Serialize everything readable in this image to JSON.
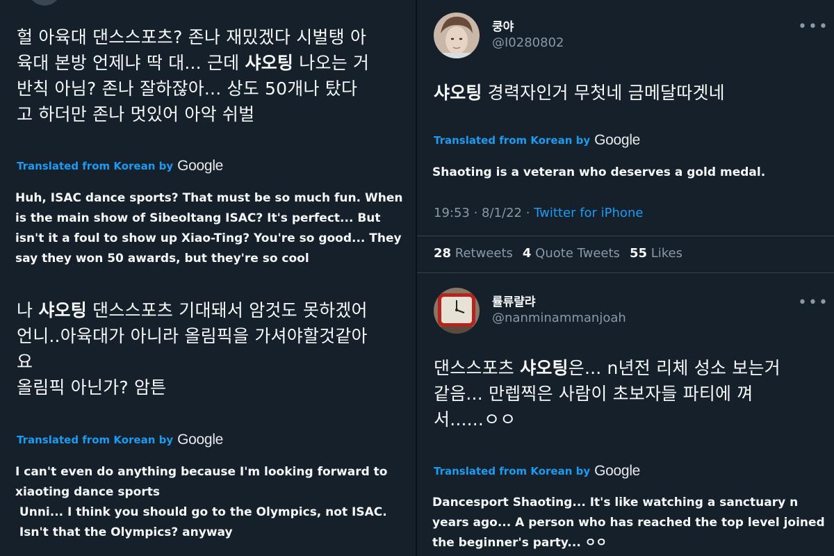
{
  "left": {
    "tweet1": {
      "korean_lines": [
        "헐 아육대 댄스스포츠? 존나 재밌겠다 시벌탱 아",
        "육대 본방 언제냐 딱 대... 근데 ",
        " 나오는 거",
        "반칙 아님? 존나 잘하잖아... 상도 50개나 탔다",
        "고 하더만 존나 멋있어 아악 쉬벌"
      ],
      "bold_word": "샤오팅",
      "translated_label": "Translated from Korean by",
      "google": "Google",
      "english_lines": [
        "Huh, ISAC dance sports? That must be so much fun. When",
        "is the main show of Sibeoltang ISAC? It's perfect... But",
        "isn't it a foul to show up Xiao-Ting? You're so good... They",
        "say they won 50 awards, but they're so cool"
      ]
    },
    "tweet2": {
      "korean_lines": [
        "나 ",
        " 댄스스포츠 기대돼서 암것도 못하겠어",
        "언니..아육대가 아니라 올림픽을 가셔야할것같아",
        "요",
        "올림픽 아닌가? 암튼"
      ],
      "bold_word": "샤오팅",
      "translated_label": "Translated from Korean by",
      "google": "Google",
      "english_lines": [
        "I can't even do anything because I'm looking forward to",
        "xiaoting dance sports",
        " Unni... I think you should go to the Olympics, not ISAC.",
        " Isn't that the Olympics? anyway"
      ]
    }
  },
  "right": {
    "tweet1": {
      "name": "쿵야",
      "handle": "@I0280802",
      "bold_word": "샤오팅",
      "korean_rest": " 경력자인거 무첫네 금메달따겟네",
      "translated_label": "Translated from Korean by",
      "google": "Google",
      "english": "Shaoting is a veteran who deserves a gold medal.",
      "time": "19:53 · 8/1/22 · ",
      "source": "Twitter for iPhone",
      "retweets_count": "28",
      "retweets_label": " Retweets",
      "quotes_count": "4",
      "quotes_label": " Quote Tweets",
      "likes_count": "55",
      "likes_label": " Likes",
      "more": "•••"
    },
    "tweet2": {
      "name": "률류랼랴",
      "handle": "@nanminammanjoah",
      "korean_lines": [
        "댄스스포츠 ",
        "은... n년전 리체 성소 보는거",
        "같음... 만렙찍은 사람이 초보자들 파티에 껴",
        "서......ㅇㅇ"
      ],
      "bold_word": "샤오팅",
      "translated_label": "Translated from Korean by",
      "google": "Google",
      "english_lines": [
        "Dancesport Shaoting... It's like watching a sanctuary n",
        "years ago... A person who has reached the top level joined",
        "the beginner's party... ㅇㅇ"
      ],
      "more": "•••"
    }
  }
}
